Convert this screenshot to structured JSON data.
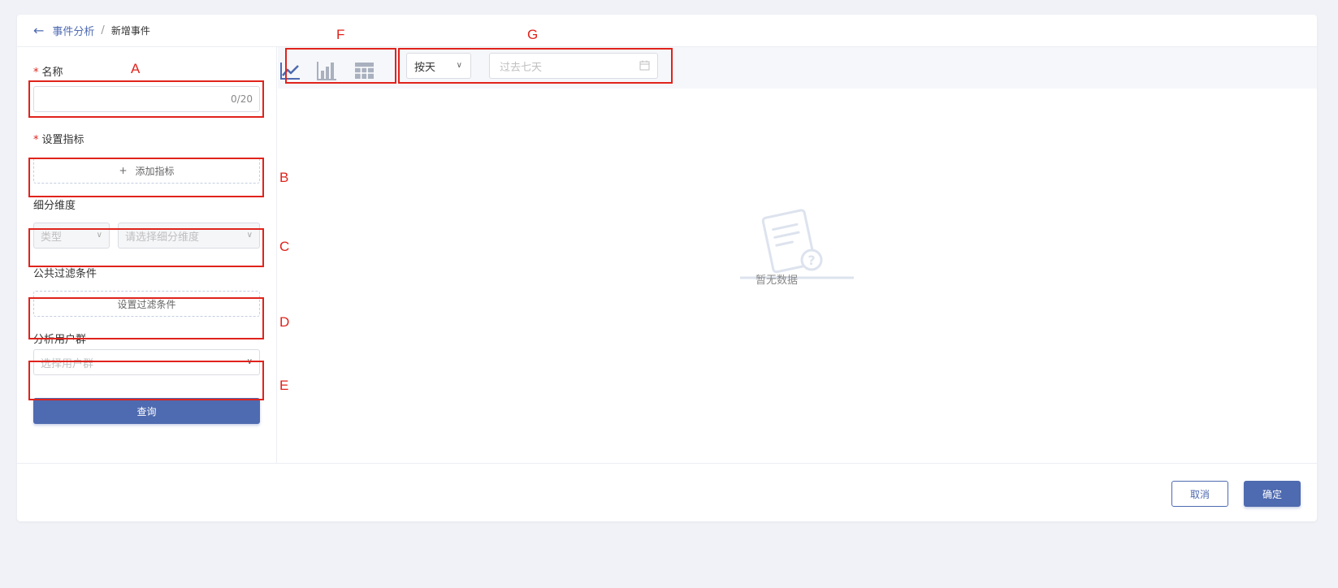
{
  "breadcrumb": {
    "back_icon": "arrow-left-icon",
    "parent": "事件分析",
    "separator": "/",
    "current": "新增事件"
  },
  "form": {
    "name": {
      "required_mark": "*",
      "label": "名称",
      "value": "",
      "counter": "0/20"
    },
    "metrics": {
      "required_mark": "*",
      "label": "设置指标",
      "add_icon": "+",
      "add_label": "添加指标"
    },
    "breakdown": {
      "label": "细分维度",
      "type_placeholder": "类型",
      "dimension_placeholder": "请选择细分维度"
    },
    "filter": {
      "label": "公共过滤条件",
      "button_label": "设置过滤条件"
    },
    "user_group": {
      "label": "分析用户群",
      "placeholder": "选择用户群"
    },
    "query_button": "查询"
  },
  "toolbar": {
    "chart_types": [
      "line-chart-icon",
      "bar-chart-icon",
      "table-icon"
    ],
    "granularity": "按天",
    "date_range_placeholder": "过去七天",
    "calendar_icon": "calendar-icon"
  },
  "empty_state": {
    "icon": "no-data-document-icon",
    "text": "暂无数据"
  },
  "footer": {
    "cancel_label": "取消",
    "confirm_label": "确定"
  },
  "annotations": {
    "color": "#e0231c",
    "labels": [
      "A",
      "B",
      "C",
      "D",
      "E",
      "F",
      "G"
    ]
  },
  "colors": {
    "primary": "#4e6ab0",
    "required": "#e0231c",
    "background": "#f0f2f7"
  }
}
